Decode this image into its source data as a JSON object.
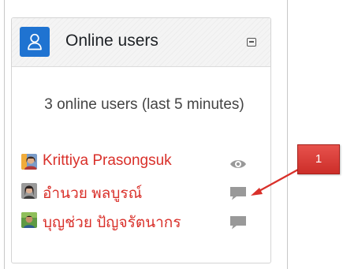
{
  "block": {
    "title": "Online users",
    "icon": "user-icon",
    "accent_color": "#1f73d1",
    "collapse_icon": "collapse-icon",
    "summary": "3 online users (last 5 minutes)"
  },
  "users": [
    {
      "name": "Krittiya Prasongsuk",
      "action_icon": "eye-icon"
    },
    {
      "name": "อำนวย พลบูรณ์",
      "action_icon": "message-icon"
    },
    {
      "name": "บุญช่วย ปัญจรัตนากร",
      "action_icon": "message-icon"
    }
  ],
  "user_link_color": "#d9302a",
  "annotation": {
    "label": "1",
    "color": "#d9302a"
  }
}
